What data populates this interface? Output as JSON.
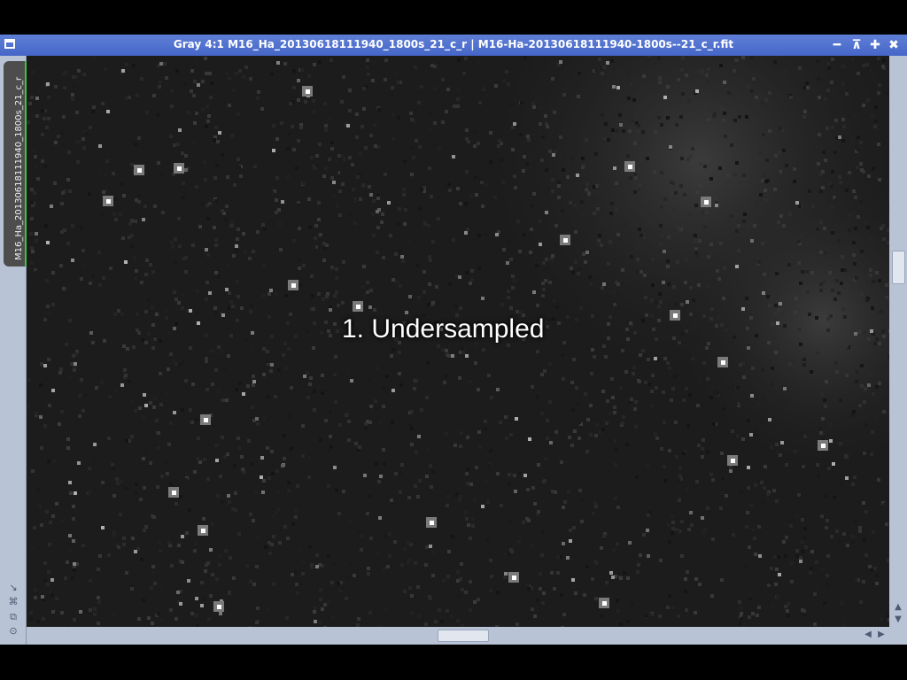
{
  "window": {
    "title": "Gray 4:1 M16_Ha_20130618111940_1800s_21_c_r | M16-Ha-20130618111940-1800s--21_c_r.fit",
    "controls": {
      "minimize": "━",
      "shade": "⊼",
      "maximize": "✚",
      "close": "✖"
    }
  },
  "side_tab": {
    "label": "M16_Ha_20130618111940_1800s_21_c_r"
  },
  "image": {
    "overlay_label": "1. Undersampled",
    "background_color": "#1c1c1c",
    "star_color": "#ffffff"
  },
  "tools": [
    "resize-icon",
    "fit-icon",
    "clone-icon",
    "target-icon"
  ],
  "scroll": {
    "up": "▲",
    "down": "▼",
    "left": "◀",
    "right": "▶"
  }
}
